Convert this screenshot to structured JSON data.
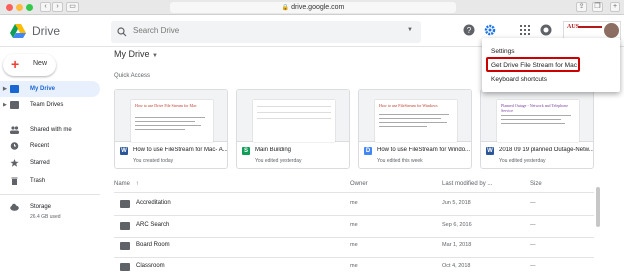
{
  "browser": {
    "url": "drive.google.com"
  },
  "app": {
    "name": "Drive",
    "logo_colors": [
      "#0f9d58",
      "#fbbc04",
      "#4285f4"
    ]
  },
  "search": {
    "placeholder": "Search Drive"
  },
  "header_icons": [
    "help-icon",
    "settings-gear-icon",
    "apps-grid-icon",
    "notifications-bell-icon"
  ],
  "account": {
    "org_label": "AUS",
    "avatar": "avatar"
  },
  "settings_menu": {
    "items": [
      "Settings",
      "Get Drive File Stream for Mac",
      "Keyboard shortcuts"
    ],
    "highlighted_index": 1,
    "highlight_color": "#cc0000"
  },
  "sidebar": {
    "new_label": "New",
    "items": [
      {
        "label": "My Drive",
        "icon": "drive-icon",
        "selected": true
      },
      {
        "label": "Team Drives",
        "icon": "team-drives-icon",
        "selected": false
      },
      {
        "label": "Shared with me",
        "icon": "people-icon",
        "selected": false
      },
      {
        "label": "Recent",
        "icon": "clock-icon",
        "selected": false
      },
      {
        "label": "Starred",
        "icon": "star-icon",
        "selected": false
      },
      {
        "label": "Trash",
        "icon": "trash-icon",
        "selected": false
      },
      {
        "label": "Storage",
        "icon": "cloud-icon",
        "selected": false
      }
    ],
    "storage_used": "26.4 GB used"
  },
  "main": {
    "title": "My Drive",
    "quick_access_label": "Quick Access",
    "cards": [
      {
        "name": "How to use FileStream for Mac- A...",
        "sub": "You created today",
        "type": "W",
        "color": "#2b579a",
        "preview_title": "How to use Drive File Stream for Mac"
      },
      {
        "name": "Main Building",
        "sub": "You edited yesterday",
        "type": "S",
        "color": "#0f9d58",
        "preview_title": ""
      },
      {
        "name": "How to use FileStream for Windo...",
        "sub": "You edited this week",
        "type": "D",
        "color": "#4285f4",
        "preview_title": "How to use FileStream for Windows"
      },
      {
        "name": "2018 09 19 planned Outage-Netw...",
        "sub": "You edited yesterday",
        "type": "W",
        "color": "#2b579a",
        "preview_title": "Planned Outage - Network and Telephone Service"
      }
    ],
    "columns": {
      "name": "Name",
      "owner": "Owner",
      "modified": "Last modified by ...",
      "size": "Size"
    },
    "files": [
      {
        "name": "Accreditation",
        "owner": "me",
        "modified": "Jun 5, 2018",
        "size": "—"
      },
      {
        "name": "ARC Search",
        "owner": "me",
        "modified": "Sep 6, 2016",
        "size": "—"
      },
      {
        "name": "Board Room",
        "owner": "me",
        "modified": "Mar 1, 2018",
        "size": "—"
      },
      {
        "name": "Classroom",
        "owner": "me",
        "modified": "Oct 4, 2018",
        "size": "—"
      }
    ]
  }
}
